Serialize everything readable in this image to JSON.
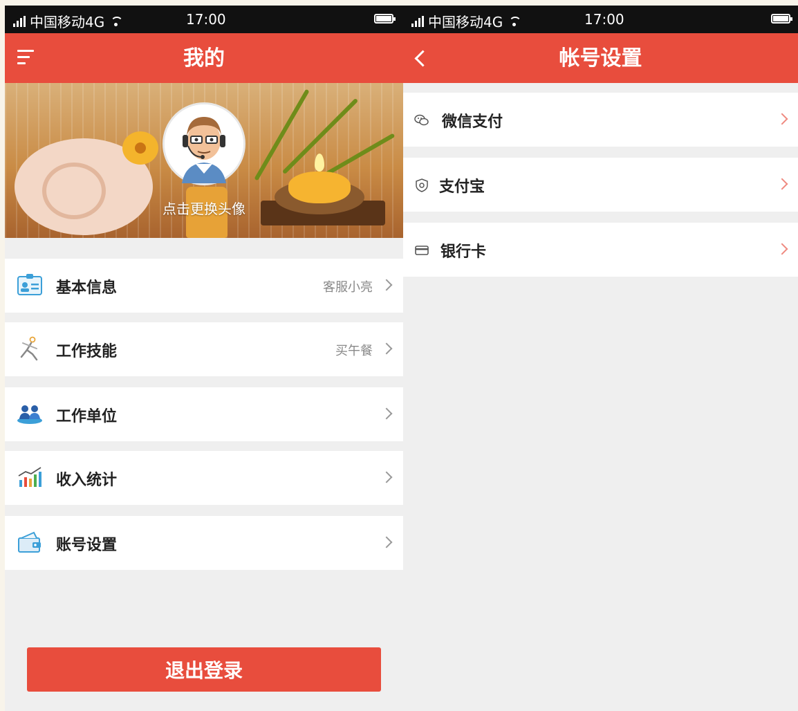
{
  "left_screen": {
    "status_bar": {
      "carrier": "中国移动4G",
      "time": "17:00"
    },
    "header": {
      "title": "我的",
      "menu_icon": "hamburger-icon"
    },
    "profile": {
      "caption": "点击更换头像"
    },
    "menu_items": [
      {
        "label": "基本信息",
        "value": "客服小亮",
        "icon": "id-card-icon"
      },
      {
        "label": "工作技能",
        "value": "买午餐",
        "icon": "runner-icon"
      },
      {
        "label": "工作单位",
        "value": "",
        "icon": "people-icon"
      },
      {
        "label": "收入统计",
        "value": "",
        "icon": "chart-icon"
      },
      {
        "label": "账号设置",
        "value": "",
        "icon": "wallet-icon"
      }
    ],
    "logout_label": "退出登录",
    "colors": {
      "accent": "#e84d3d",
      "background": "#efefef"
    }
  },
  "right_screen": {
    "status_bar": {
      "carrier": "中国移动4G",
      "time": "17:00"
    },
    "header": {
      "title": "帐号设置",
      "back_icon": "back-chevron-icon"
    },
    "items": [
      {
        "label": "微信支付",
        "icon": "wechat-icon"
      },
      {
        "label": "支付宝",
        "icon": "alipay-icon"
      },
      {
        "label": "银行卡",
        "icon": "bank-card-icon"
      }
    ]
  }
}
